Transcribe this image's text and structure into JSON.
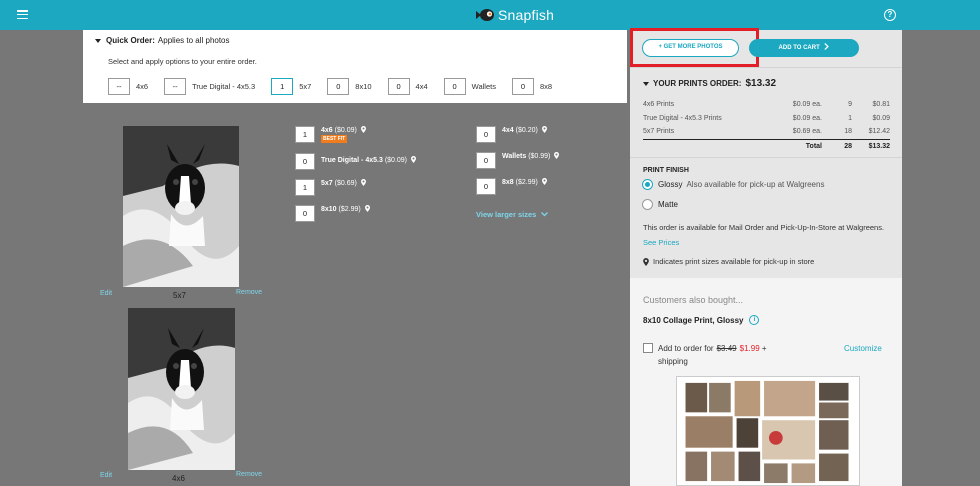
{
  "topbar": {
    "brand": "Snapfish",
    "help_icon": "question-circle-icon",
    "menu_icon": "hamburger-icon",
    "logo_icon": "fish-logo-icon",
    "color": "#1ba8c0"
  },
  "quick_order": {
    "title": "Quick Order:",
    "title_suffix": "Applies to all photos",
    "subtitle": "Select and apply options to your entire order.",
    "options": [
      {
        "value": "--",
        "label": "4x6"
      },
      {
        "value": "--",
        "label": "True Digital - 4x5.3"
      },
      {
        "value": "1",
        "label": "5x7"
      },
      {
        "value": "0",
        "label": "8x10"
      },
      {
        "value": "0",
        "label": "4x4"
      },
      {
        "value": "0",
        "label": "Wallets"
      },
      {
        "value": "0",
        "label": "8x8"
      }
    ]
  },
  "photos": [
    {
      "caption": "5x7",
      "edit": "Edit",
      "remove": "Remove"
    },
    {
      "caption": "4x6",
      "edit": "Edit",
      "remove": "Remove"
    }
  ],
  "sizes_left": [
    {
      "qty": "1",
      "name": "4x6",
      "price": "($0.09)",
      "badge": "BEST FIT"
    },
    {
      "qty": "0",
      "name": "True Digital - 4x5.3",
      "price": "($0.09)",
      "badge": ""
    },
    {
      "qty": "1",
      "name": "5x7",
      "price": "($0.69)",
      "badge": ""
    },
    {
      "qty": "0",
      "name": "8x10",
      "price": "($2.99)",
      "badge": ""
    }
  ],
  "sizes_right": [
    {
      "qty": "0",
      "name": "4x4",
      "price": "($0.20)"
    },
    {
      "qty": "0",
      "name": "Wallets",
      "price": "($0.99)"
    },
    {
      "qty": "0",
      "name": "8x8",
      "price": "($2.99)"
    }
  ],
  "view_larger": "View larger sizes",
  "buttons": {
    "get_more": "+ GET MORE PHOTOS",
    "add_to_cart": "ADD TO CART"
  },
  "order": {
    "heading": "YOUR PRINTS ORDER:",
    "amount": "$13.32",
    "rows": [
      {
        "name": "4x6 Prints",
        "each": "$0.09 ea.",
        "qty": "9",
        "total": "$0.81"
      },
      {
        "name": "True Digital - 4x5.3 Prints",
        "each": "$0.09 ea.",
        "qty": "1",
        "total": "$0.09"
      },
      {
        "name": "5x7 Prints",
        "each": "$0.69 ea.",
        "qty": "18",
        "total": "$12.42"
      }
    ],
    "total_label": "Total",
    "total_qty": "28",
    "total_amount": "$13.32"
  },
  "print_finish": {
    "title": "PRINT FINISH",
    "glossy": "Glossy",
    "glossy_note": "Also available for pick-up at Walgreens",
    "matte": "Matte",
    "info": "This order is available for Mail Order and Pick-Up-In-Store at Walgreens.",
    "see_prices": "See Prices",
    "pin_note": "Indicates print sizes available for pick-up in store"
  },
  "cross_sell": {
    "title": "Customers also bought...",
    "product": "8x10 Collage Print, Glossy",
    "add_prefix": "Add to order for",
    "old_price": "$3.49",
    "new_price": "$1.99",
    "suffix": "+",
    "shipping": "shipping",
    "customize": "Customize"
  },
  "colors": {
    "accent": "#1ba8c0",
    "highlight": "#e21f26",
    "badge": "#f07c1e",
    "sale": "#e21f26"
  }
}
